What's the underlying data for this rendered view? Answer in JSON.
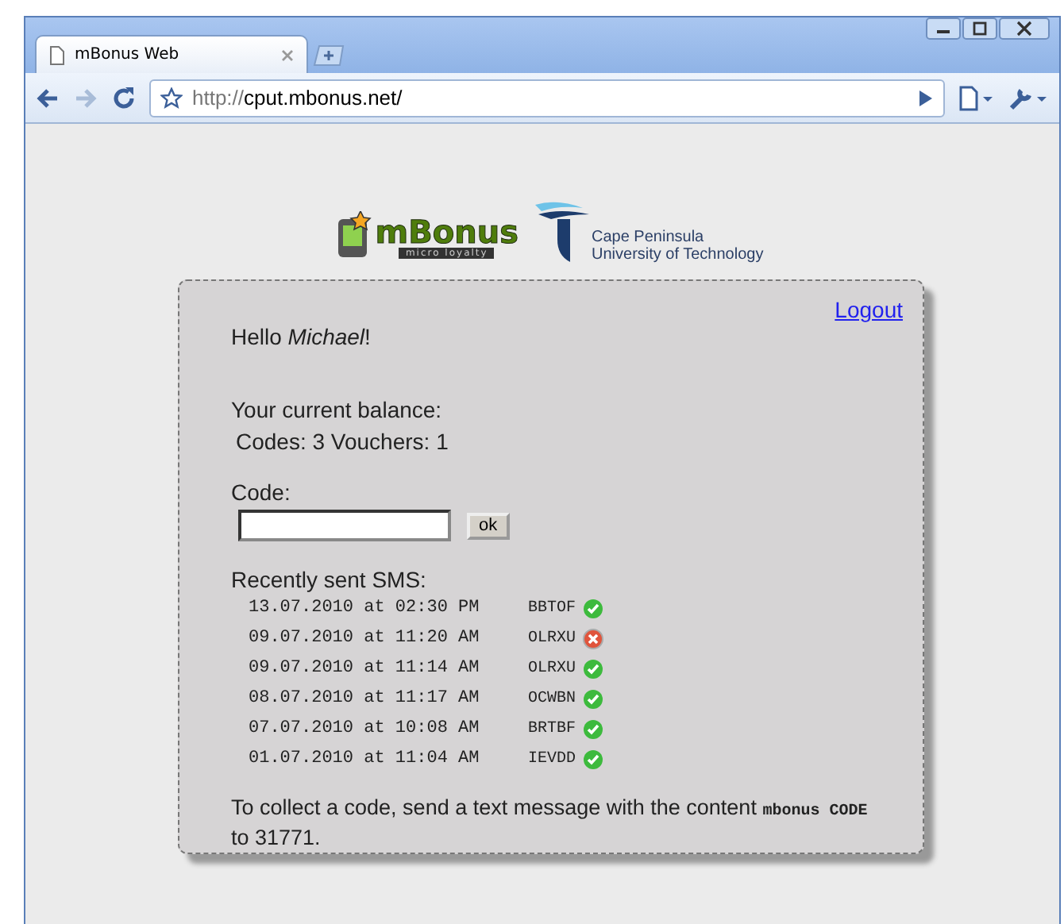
{
  "window": {
    "tab_title": "mBonus Web",
    "url_scheme": "http://",
    "url_rest": "cput.mbonus.net/"
  },
  "header": {
    "logo_text": "mBonus",
    "logo_tagline": "micro loyalty",
    "university_line1": "Cape Peninsula",
    "university_line2": "University of Technology"
  },
  "logout": "Logout",
  "greeting": {
    "before": "Hello ",
    "name": "Michael",
    "after": "!"
  },
  "balance_label": "Your current balance:",
  "balance": "Codes: 3 Vouchers: 1",
  "code_label": "Code:",
  "ok_button": "ok",
  "sms_label": "Recently sent SMS:",
  "sms": [
    {
      "date": "13.07.2010 at 02:30 PM",
      "code": "BBTOF",
      "success": true
    },
    {
      "date": "09.07.2010 at 11:20 AM",
      "code": "OLRXU",
      "success": false
    },
    {
      "date": "09.07.2010 at 11:14 AM",
      "code": "OLRXU",
      "success": true
    },
    {
      "date": "08.07.2010 at 11:17 AM",
      "code": "OCWBN",
      "success": true
    },
    {
      "date": "07.07.2010 at 10:08 AM",
      "code": "BRTBF",
      "success": true
    },
    {
      "date": "01.07.2010 at 11:04 AM",
      "code": "IEVDD",
      "success": true
    }
  ],
  "instruction": {
    "before": "To collect a code, send a text message with the content ",
    "command": "mbonus CODE",
    "after": " to 31771."
  }
}
